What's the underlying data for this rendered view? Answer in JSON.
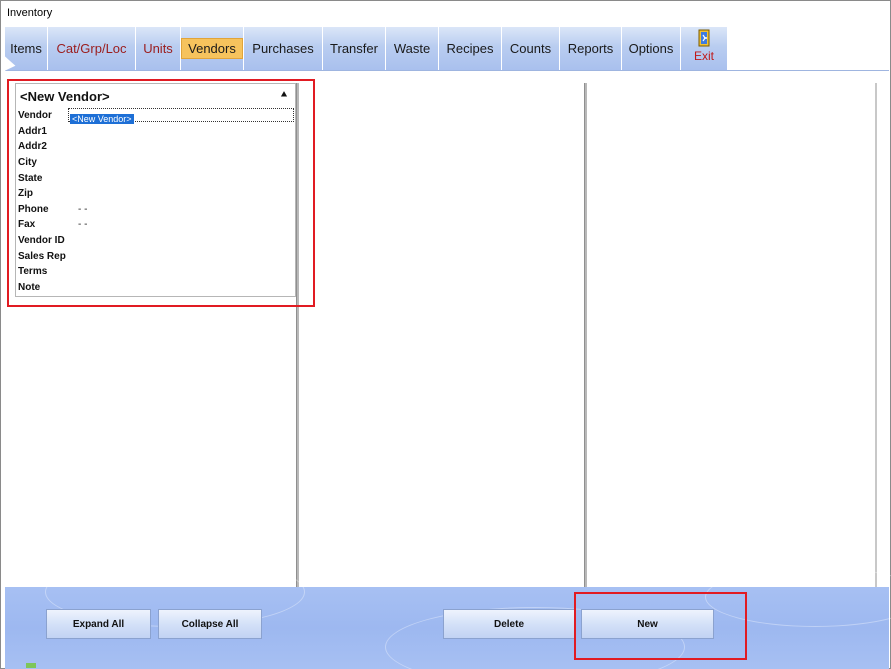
{
  "window": {
    "title": "Inventory"
  },
  "tabs": [
    {
      "label": "Items",
      "style": "normal"
    },
    {
      "label": "Cat/Grp/Loc",
      "style": "red"
    },
    {
      "label": "Units",
      "style": "red"
    },
    {
      "label": "Vendors",
      "style": "active"
    },
    {
      "label": "Purchases",
      "style": "normal"
    },
    {
      "label": "Transfer",
      "style": "normal"
    },
    {
      "label": "Waste",
      "style": "normal"
    },
    {
      "label": "Recipes",
      "style": "normal"
    },
    {
      "label": "Counts",
      "style": "normal"
    },
    {
      "label": "Reports",
      "style": "normal"
    },
    {
      "label": "Options",
      "style": "normal"
    }
  ],
  "exit": {
    "label": "Exit",
    "icon": "exit-door-icon"
  },
  "vendor_card": {
    "title": "<New Vendor>",
    "collapse_icon": "double-chevron-up-icon",
    "vendor_value": "<New Vendor>",
    "labels": {
      "vendor": "Vendor",
      "addr1": "Addr1",
      "addr2": "Addr2",
      "city": "City",
      "state": "State",
      "zip": "Zip",
      "phone": "Phone",
      "fax": "Fax",
      "vendor_id": "Vendor ID",
      "sales_rep": "Sales Rep",
      "terms": "Terms",
      "note": "Note"
    },
    "phone_value": "-  -",
    "fax_value": "-  -"
  },
  "buttons": {
    "expand_all": "Expand All",
    "collapse_all": "Collapse All",
    "delete": "Delete",
    "new": "New"
  },
  "colors": {
    "accent_tab": "#f6c35d",
    "toolbar_blue": "#a7c0f3",
    "highlight_red": "#e11b22",
    "selection_blue": "#1d6fd6"
  }
}
